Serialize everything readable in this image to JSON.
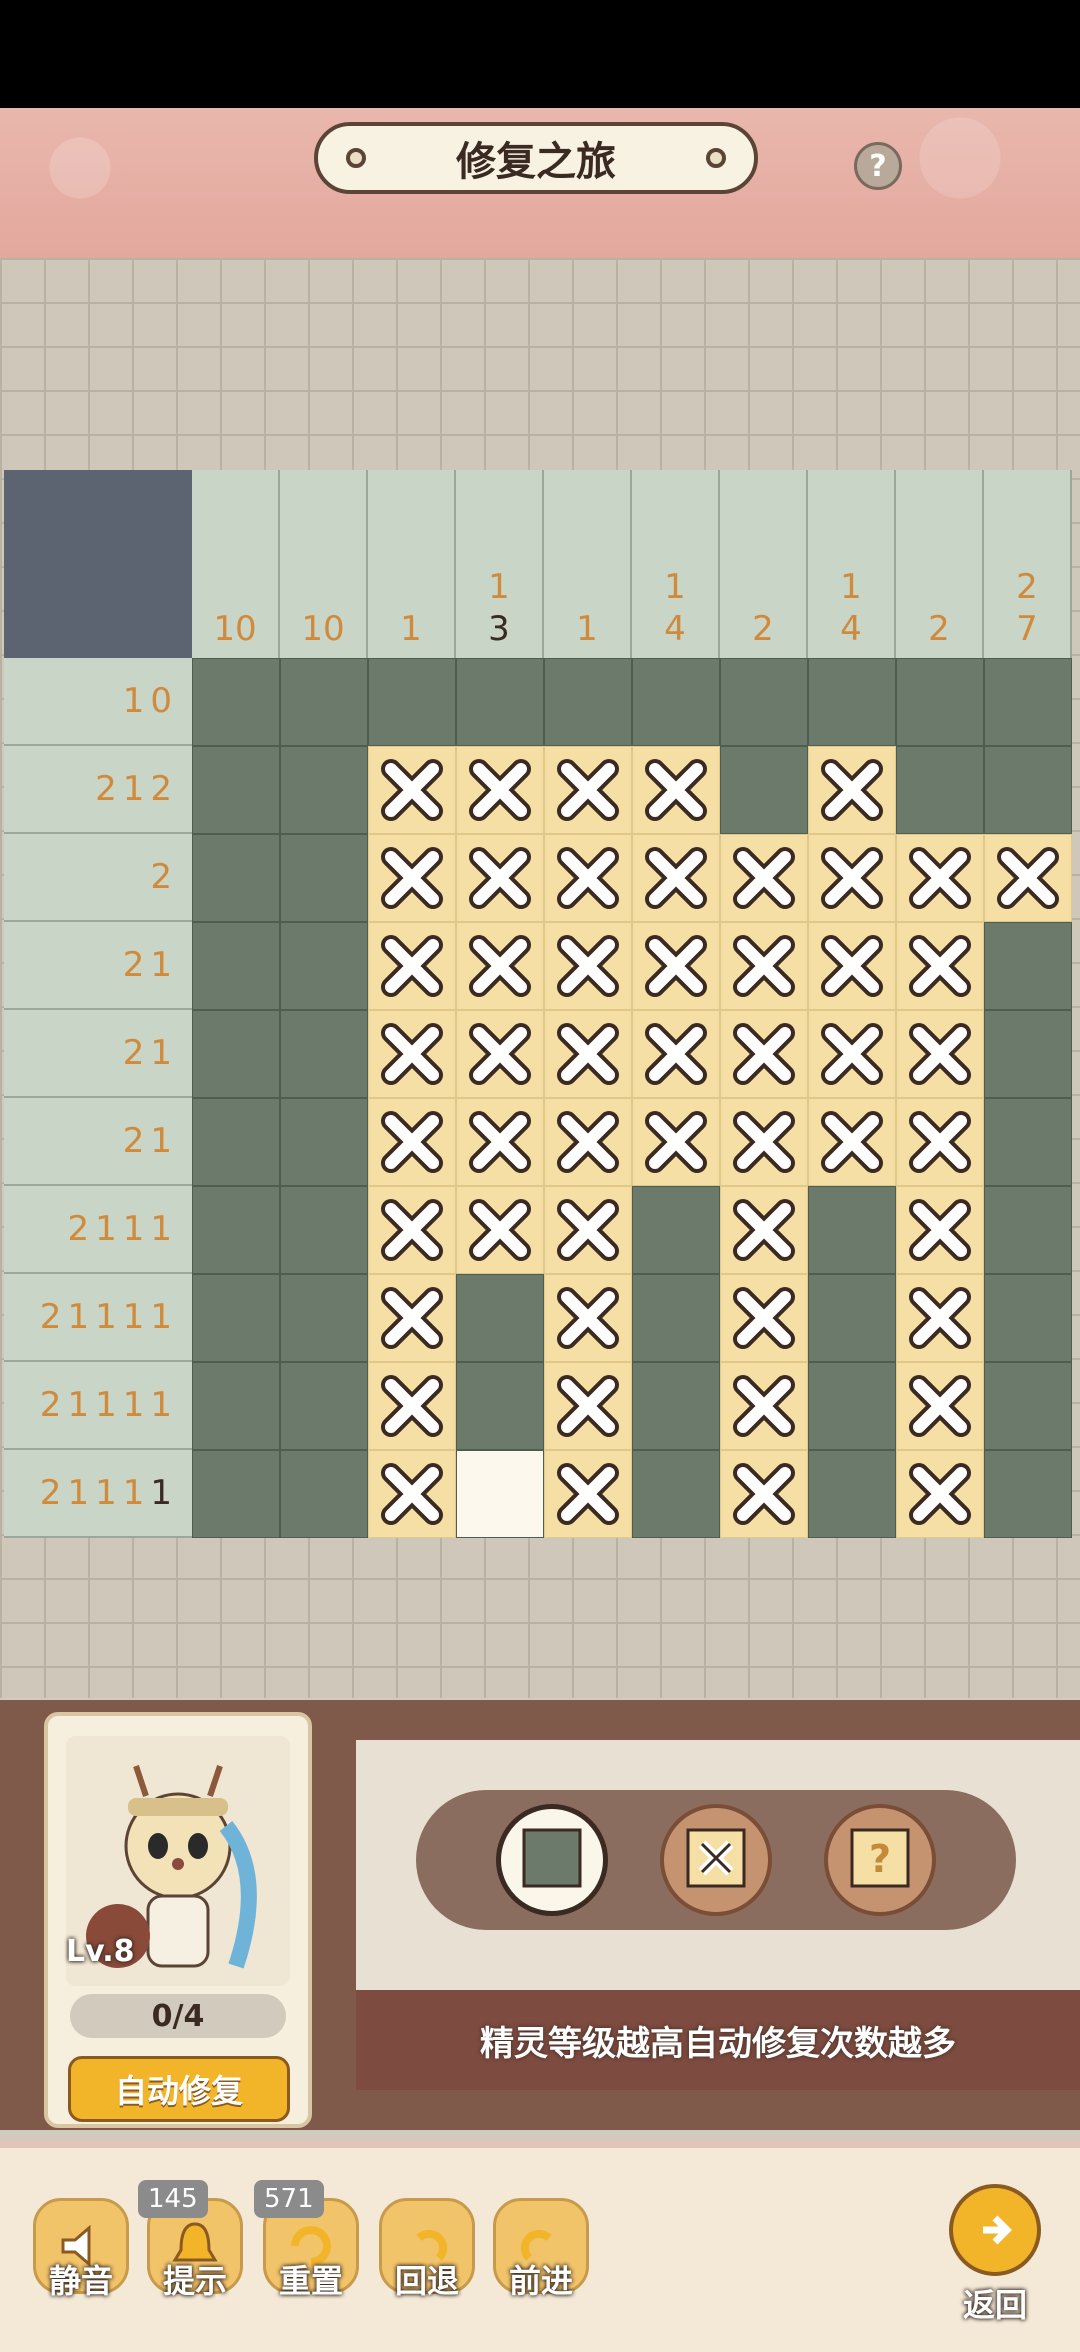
{
  "header": {
    "title": "修复之旅",
    "help_icon": "question-icon",
    "help_label": "?"
  },
  "puzzle": {
    "column_clues": [
      [
        "10"
      ],
      [
        "10"
      ],
      [
        "1"
      ],
      [
        "1",
        "3"
      ],
      [
        "1"
      ],
      [
        "1",
        "4"
      ],
      [
        "2"
      ],
      [
        "1",
        "4"
      ],
      [
        "2"
      ],
      [
        "2",
        "7"
      ]
    ],
    "column_clue_done": [
      [
        false
      ],
      [
        false
      ],
      [
        false
      ],
      [
        false,
        true
      ],
      [
        false
      ],
      [
        false,
        false
      ],
      [
        false
      ],
      [
        false,
        false
      ],
      [
        false
      ],
      [
        false,
        false
      ]
    ],
    "row_clues": [
      [
        "10"
      ],
      [
        "2",
        "1",
        "2"
      ],
      [
        "2"
      ],
      [
        "2",
        "1"
      ],
      [
        "2",
        "1"
      ],
      [
        "2",
        "1"
      ],
      [
        "2",
        "1",
        "1",
        "1"
      ],
      [
        "2",
        "1",
        "1",
        "1",
        "1"
      ],
      [
        "2",
        "1",
        "1",
        "1",
        "1"
      ],
      [
        "2",
        "1",
        "1",
        "1",
        "1"
      ]
    ],
    "row_clue_done": [
      [
        false
      ],
      [
        false,
        false,
        false
      ],
      [
        false
      ],
      [
        false,
        false
      ],
      [
        false,
        false
      ],
      [
        false,
        false
      ],
      [
        false,
        false,
        false,
        false
      ],
      [
        false,
        false,
        false,
        false,
        false
      ],
      [
        false,
        false,
        false,
        false,
        false
      ],
      [
        false,
        false,
        false,
        false,
        true
      ]
    ],
    "grid": [
      "FFFFFFFFFF",
      "FFXXXXFXFF",
      "FFXXXXXXXX",
      "FFXXXXXXXF",
      "FFXXXXXXXF",
      "FFXXXXXXXF",
      "FFXXXFXFXF",
      "FFXFXFXFXF",
      "FFXFXFXFXF",
      "FFXEXFXFXF"
    ]
  },
  "sprite": {
    "level": "Lv.8",
    "progress": "0/4",
    "auto_repair_label": "自动修复"
  },
  "tools": {
    "fill_icon": "fill-square-icon",
    "mark_icon": "x-mark-icon",
    "unknown_icon": "question-tile-icon",
    "tip": "精灵等级越高自动修复次数越多"
  },
  "toolbar": {
    "mute_label": "静音",
    "mute_icon": "speaker-icon",
    "hint_label": "提示",
    "hint_icon": "bell-icon",
    "hint_count": "145",
    "reset_label": "重置",
    "reset_icon": "reset-icon",
    "reset_count": "571",
    "undo_label": "回退",
    "undo_icon": "undo-icon",
    "redo_label": "前进",
    "redo_icon": "redo-icon",
    "return_label": "返回",
    "return_icon": "return-arrow-icon"
  },
  "colors": {
    "filled": "#6b7a6b",
    "marked": "#f6dfa4",
    "clue": "#d08a3c",
    "clue_done": "#3a2a22"
  }
}
